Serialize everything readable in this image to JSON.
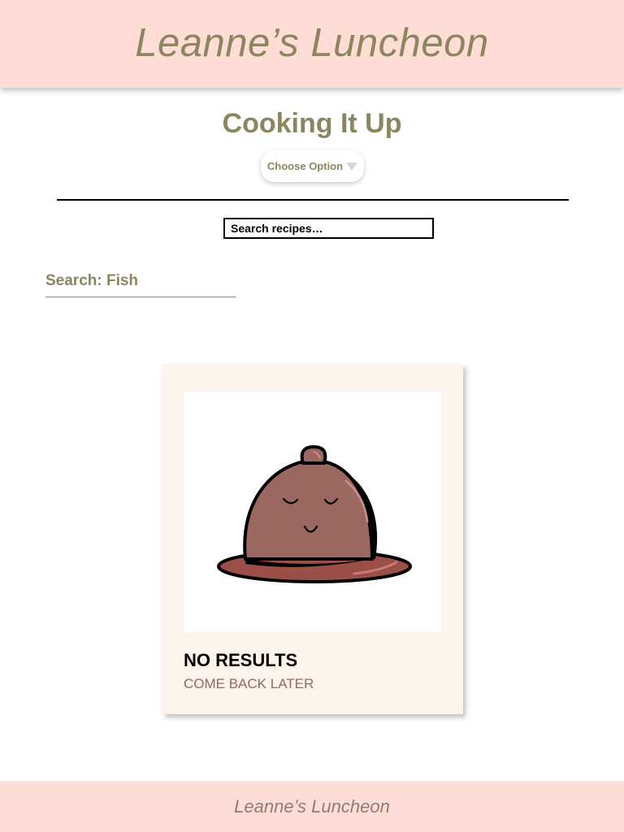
{
  "header": {
    "title": "Leanne’s Luncheon"
  },
  "main": {
    "title": "Cooking It Up",
    "choose_option": {
      "label": "Choose Option"
    },
    "search": {
      "placeholder": "Search recipes…"
    },
    "search_term": "Search: Fish"
  },
  "result_card": {
    "image_icon": "cloche-face-icon",
    "title": "NO RESULTS",
    "subtitle": "COME BACK LATER"
  },
  "footer": {
    "text": "Leanne’s Luncheon"
  },
  "colors": {
    "header_bg": "#ffddd6",
    "accent_olive": "#8b8660",
    "card_bg": "#fcf4ea",
    "cloche_brown": "#9b6761"
  }
}
